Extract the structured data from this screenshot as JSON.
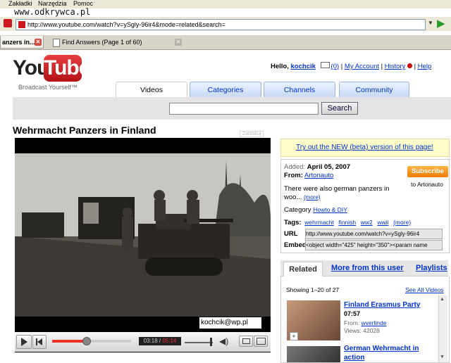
{
  "browser": {
    "menu": [
      "Zakładki",
      "Narzędzia",
      "Pomoc"
    ],
    "watermark": "www.odkrywca.pl",
    "url": "http://www.youtube.com/watch?v=ySgly-96ir4&mode=related&search=",
    "tabs": [
      {
        "label": "anzers in..."
      },
      {
        "label": "Find Answers (Page 1 of 60)"
      }
    ]
  },
  "header": {
    "logo_you": "You",
    "logo_tube": "Tube",
    "tagline": "Broadcast Yourself™",
    "hello": "Hello,",
    "username": "kochcik",
    "inbox": "(0)",
    "my_account": "My Account",
    "history": "History",
    "help": "Help",
    "nav_tabs": [
      "Videos",
      "Categories",
      "Channels",
      "Community"
    ],
    "search_button": "Search",
    "search_value": ""
  },
  "video": {
    "title": "Wehrmacht Panzers in Finland",
    "block_label": "Zablokuj",
    "overlay_email": "kochcik@wp.pl",
    "time_current": "03:18",
    "time_total": "05:14",
    "progress": 0.43
  },
  "sidebar": {
    "beta_link": "Try out the NEW (beta) version of this page!",
    "added_label": "Added:",
    "added_date": "April 05, 2007",
    "from_label": "From:",
    "from_user": "Artonauto",
    "subscribe": "Subscribe",
    "subscribe_to": "to Artonauto",
    "description": "There were also german panzers in",
    "description_2": "woo...",
    "more": "(more)",
    "category_label": "Category",
    "category": "Howto & DIY",
    "tags_label": "Tags:",
    "tags": [
      "wehrmacht",
      "finnish",
      "ww2",
      "wwii"
    ],
    "tags_more": "(more)",
    "url_label": "URL",
    "url_value": "http://www.youtube.com/watch?v=ySgly-96ir4",
    "embed_label": "Embed",
    "embed_value": "<object width=\"425\" height=\"350\"><param name",
    "tabs": [
      "Related",
      "More from this user",
      "Playlists"
    ],
    "showing": "Showing 1–20 of 27",
    "see_all": "See All Videos",
    "related": [
      {
        "title": "Finland Erasmus Party",
        "duration": "07:57",
        "from_label": "From:",
        "from": "wverlinde",
        "views": "Views: 42028"
      },
      {
        "title": "German Wehrmacht in",
        "title_2": "action"
      }
    ]
  },
  "colors": {
    "youtube_red": "#cc181e",
    "link_blue": "#0033cc",
    "subscribe_orange": "#f07a00",
    "beta_bg": "#ffffcc"
  }
}
